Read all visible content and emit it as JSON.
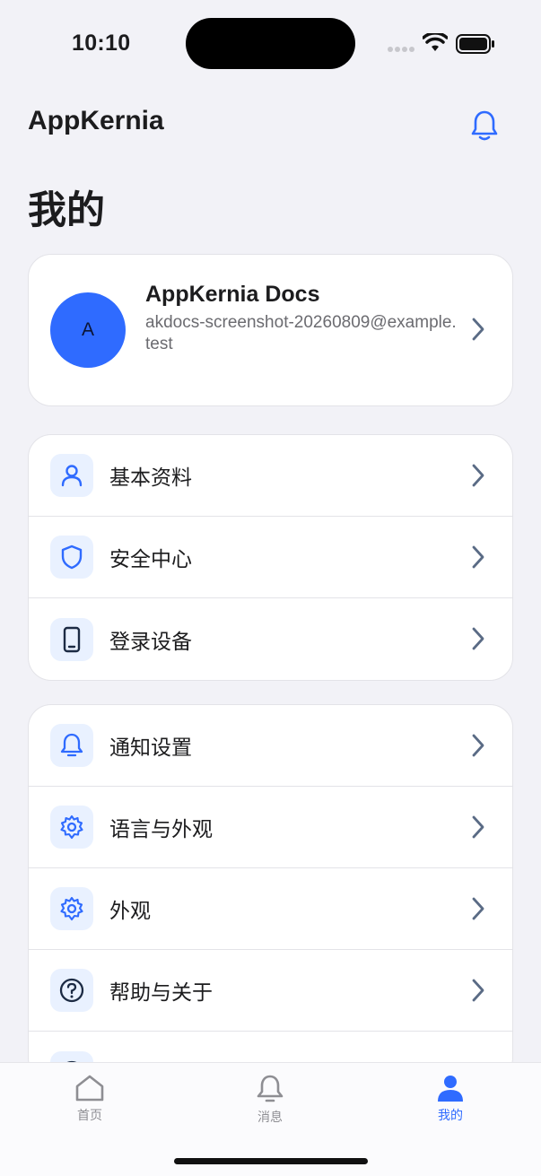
{
  "status_bar": {
    "time": "10:10"
  },
  "header": {
    "app_title": "AppKernia",
    "notification_icon": "bell-icon"
  },
  "page": {
    "title": "我的"
  },
  "profile": {
    "avatar_letter": "A",
    "name": "AppKernia Docs",
    "email": "akdocs-screenshot-20260809@example.test"
  },
  "groups": [
    {
      "items": [
        {
          "label": "基本资料",
          "icon": "person-icon"
        },
        {
          "label": "安全中心",
          "icon": "shield-icon"
        },
        {
          "label": "登录设备",
          "icon": "phone-device-icon"
        }
      ]
    },
    {
      "items": [
        {
          "label": "通知设置",
          "icon": "bell-icon"
        },
        {
          "label": "语言与外观",
          "icon": "gear-icon"
        },
        {
          "label": "外观",
          "icon": "gear-icon"
        },
        {
          "label": "帮助与关于",
          "icon": "question-circle-icon"
        }
      ]
    }
  ],
  "tabbar": {
    "tabs": [
      {
        "label": "首页",
        "icon": "home-icon",
        "active": false
      },
      {
        "label": "消息",
        "icon": "bell-icon",
        "active": false
      },
      {
        "label": "我的",
        "icon": "person-icon",
        "active": true
      }
    ]
  },
  "colors": {
    "accent": "#2f6bff",
    "background": "#f2f2f7",
    "icon_bg": "#e9f1ff",
    "chevron": "#5a6b85"
  }
}
